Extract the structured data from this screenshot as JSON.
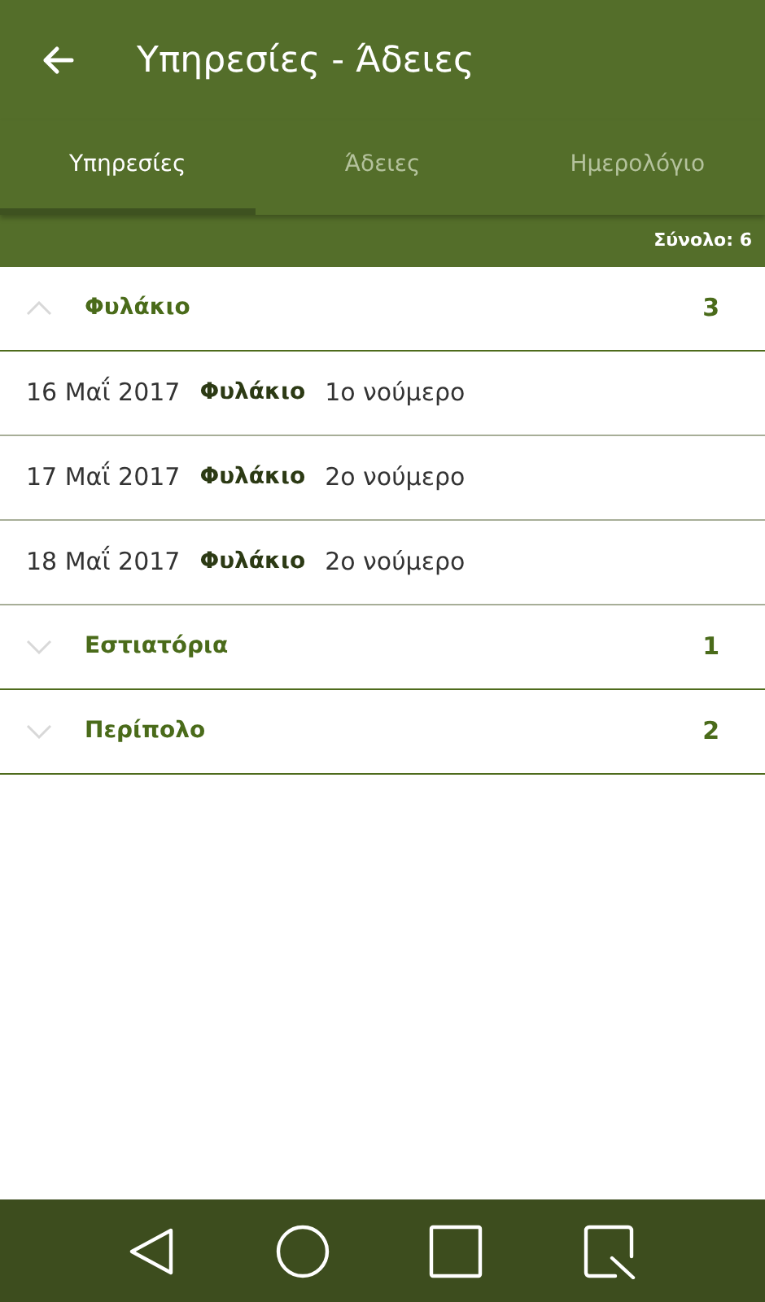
{
  "app_bar": {
    "title": "Υπηρεσίες - Άδειες"
  },
  "tabs": [
    {
      "label": "Υπηρεσίες",
      "selected": true
    },
    {
      "label": "Άδειες",
      "selected": false
    },
    {
      "label": "Ημερολόγιο",
      "selected": false
    }
  ],
  "total": "Σύνολο: 6",
  "groups": [
    {
      "name": "Φυλάκιο",
      "count": "3",
      "expanded": true,
      "entries": [
        {
          "date": "16 Μαΐ 2017",
          "category": "Φυλάκιο",
          "detail": "1ο νούμερο"
        },
        {
          "date": "17 Μαΐ 2017",
          "category": "Φυλάκιο",
          "detail": "2ο νούμερο"
        },
        {
          "date": "18 Μαΐ 2017",
          "category": "Φυλάκιο",
          "detail": "2ο νούμερο"
        }
      ]
    },
    {
      "name": "Εστιατόρια",
      "count": "1",
      "expanded": false
    },
    {
      "name": "Περίπολο",
      "count": "2",
      "expanded": false
    }
  ]
}
